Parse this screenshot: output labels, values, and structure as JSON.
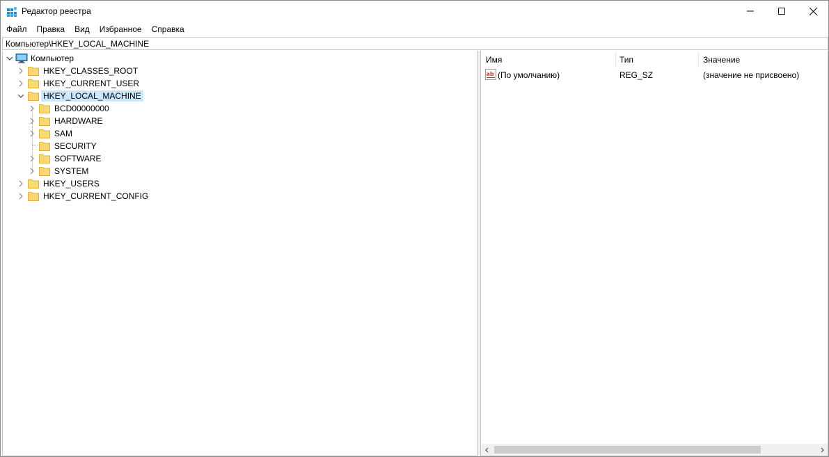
{
  "window": {
    "title": "Редактор реестра"
  },
  "menu": [
    "Файл",
    "Правка",
    "Вид",
    "Избранное",
    "Справка"
  ],
  "address": "Компьютер\\HKEY_LOCAL_MACHINE",
  "tree": {
    "root": "Компьютер",
    "hives": [
      {
        "label": "HKEY_CLASSES_ROOT",
        "expanded": false
      },
      {
        "label": "HKEY_CURRENT_USER",
        "expanded": false
      },
      {
        "label": "HKEY_LOCAL_MACHINE",
        "expanded": true,
        "selected": true,
        "children": [
          {
            "label": "BCD00000000",
            "has_children": true
          },
          {
            "label": "HARDWARE",
            "has_children": true
          },
          {
            "label": "SAM",
            "has_children": true
          },
          {
            "label": "SECURITY",
            "has_children": false
          },
          {
            "label": "SOFTWARE",
            "has_children": true
          },
          {
            "label": "SYSTEM",
            "has_children": true
          }
        ]
      },
      {
        "label": "HKEY_USERS",
        "expanded": false
      },
      {
        "label": "HKEY_CURRENT_CONFIG",
        "expanded": false
      }
    ]
  },
  "list": {
    "columns": [
      "Имя",
      "Тип",
      "Значение"
    ],
    "rows": [
      {
        "name": "(По умолчанию)",
        "type": "REG_SZ",
        "value": "(значение не присвоено)",
        "icon": "string-value-icon"
      }
    ]
  },
  "colors": {
    "selection": "#cce8ff",
    "folder": "#f8d775",
    "folder_dark": "#e0b23c"
  }
}
